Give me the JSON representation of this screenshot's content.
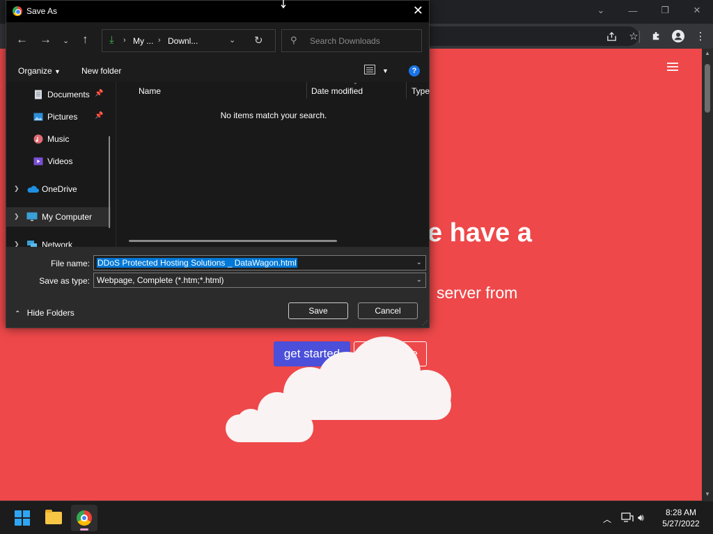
{
  "browser": {
    "window_controls": {
      "tab_search": "⌄",
      "minimize": "—",
      "restore": "❐",
      "close": "✕"
    },
    "toolbar_icons": [
      "share-icon",
      "star-icon",
      "extensions-icon",
      "profile-icon",
      "menu-icon"
    ]
  },
  "page": {
    "hero_title": "e have a",
    "hero_subtitle": "server from",
    "get_started_label": "get started",
    "secondary_button_label": "e",
    "accent_color": "#ee484a",
    "button_color": "#4b4fd9"
  },
  "dialog": {
    "title": "Save As",
    "address": {
      "crumb_1": "My ...",
      "crumb_2": "Downl..."
    },
    "search": {
      "placeholder": "Search Downloads"
    },
    "commands": {
      "organize": "Organize",
      "new_folder": "New folder"
    },
    "nav_items": [
      {
        "label": "Documents",
        "icon": "documents-icon",
        "pinned": true
      },
      {
        "label": "Pictures",
        "icon": "pictures-icon",
        "pinned": true
      },
      {
        "label": "Music",
        "icon": "music-icon",
        "pinned": false
      },
      {
        "label": "Videos",
        "icon": "videos-icon",
        "pinned": false
      },
      {
        "label": "OneDrive",
        "icon": "onedrive-icon",
        "pinned": false
      },
      {
        "label": "My Computer",
        "icon": "computer-icon",
        "pinned": false,
        "selected": true
      },
      {
        "label": "Network",
        "icon": "network-icon",
        "pinned": false
      }
    ],
    "columns": [
      "Name",
      "Date modified",
      "Type"
    ],
    "empty_message": "No items match your search.",
    "file_name_label": "File name:",
    "file_name_value": "DDoS Protected Hosting Solutions _ DataWagon.html",
    "save_as_type_label": "Save as type:",
    "save_as_type_value": "Webpage, Complete (*.htm;*.html)",
    "hide_folders_label": "Hide Folders",
    "save_label": "Save",
    "cancel_label": "Cancel"
  },
  "taskbar": {
    "apps": [
      "start-icon",
      "file-explorer-icon",
      "chrome-icon"
    ],
    "time": "8:28 AM",
    "date": "5/27/2022"
  }
}
